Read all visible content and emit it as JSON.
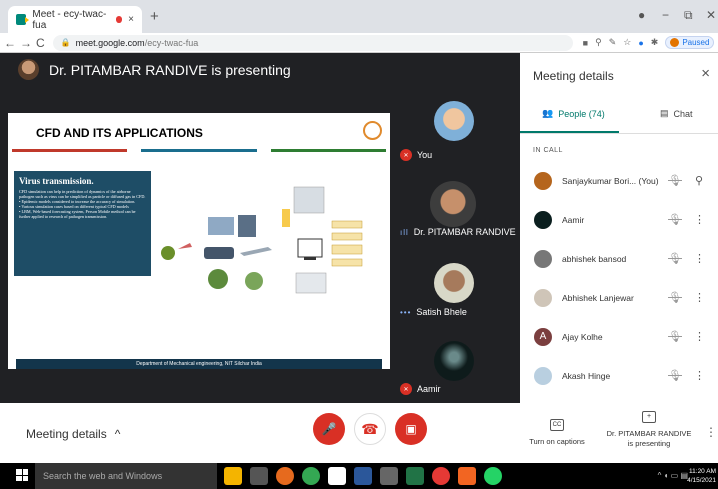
{
  "browser": {
    "tab_title": "Meet - ecy-twac-fua",
    "tab_close": "×",
    "new_tab": "+",
    "url_host": "meet.google.com",
    "url_path": "/ecy-twac-fua",
    "paused_label": "Paused",
    "win_minimize": "−",
    "win_restore": "⧉",
    "win_close": "✕",
    "back": "←",
    "forward": "→",
    "reload": "C",
    "menu": "⋮"
  },
  "presenter": {
    "banner": "Dr. PITAMBAR RANDIVE is presenting"
  },
  "slide": {
    "title": "CFD AND ITS APPLICATIONS",
    "box_title": "Virus  transmission.",
    "box_lines": [
      "CFD simulation can help in prediction of dynamics of the airborne pathogen such as virus can be simplified as particle or diffused gas in CFD.",
      "• Epidemic models considered to increase the accuracy of simulation.",
      "• Various simulation cases based on different typical CFD models",
      "• LBM, Web-based forecasting system, Person Mobile method can be further applied to research of pathogen transmission."
    ],
    "footer": "Department of Mechanical engineering, NIT Silchar India",
    "line_colors": [
      "#c0392b",
      "#1a6e8e",
      "#2e7d32"
    ]
  },
  "tiles": [
    {
      "name": "You",
      "status": "muted"
    },
    {
      "name": "Dr. PITAMBAR RANDIVE",
      "status": "speaking"
    },
    {
      "name": "Satish Bhele",
      "status": "speaking"
    },
    {
      "name": "Aamir",
      "status": "muted"
    }
  ],
  "sidebar": {
    "title": "Meeting details",
    "close": "×",
    "people_tab": "People (74)",
    "chat_tab": "Chat",
    "in_call_label": "IN CALL",
    "participants": [
      {
        "name": "Sanjaykumar Bori...  (You)",
        "avatar_color": "#b5651d"
      },
      {
        "name": "Aamir",
        "avatar_color": "#0b1f1f"
      },
      {
        "name": "abhishek bansod",
        "avatar_color": "#777777"
      },
      {
        "name": "Abhishek Lanjewar",
        "avatar_color": "#cfc5b8"
      },
      {
        "name": "Ajay Kolhe",
        "avatar_color": "#7b3f3f",
        "initial": "A"
      },
      {
        "name": "Akash Hinge",
        "avatar_color": "#b9cfe0"
      }
    ]
  },
  "bottom_bar": {
    "meeting_details": "Meeting details",
    "captions_label": "Turn on captions",
    "presenting_label": "Dr. PITAMBAR RANDIVE is presenting",
    "more": "⋮"
  },
  "taskbar": {
    "search_placeholder": "Search the web and Windows",
    "time": "11:20 AM",
    "date": "4/15/2021"
  }
}
